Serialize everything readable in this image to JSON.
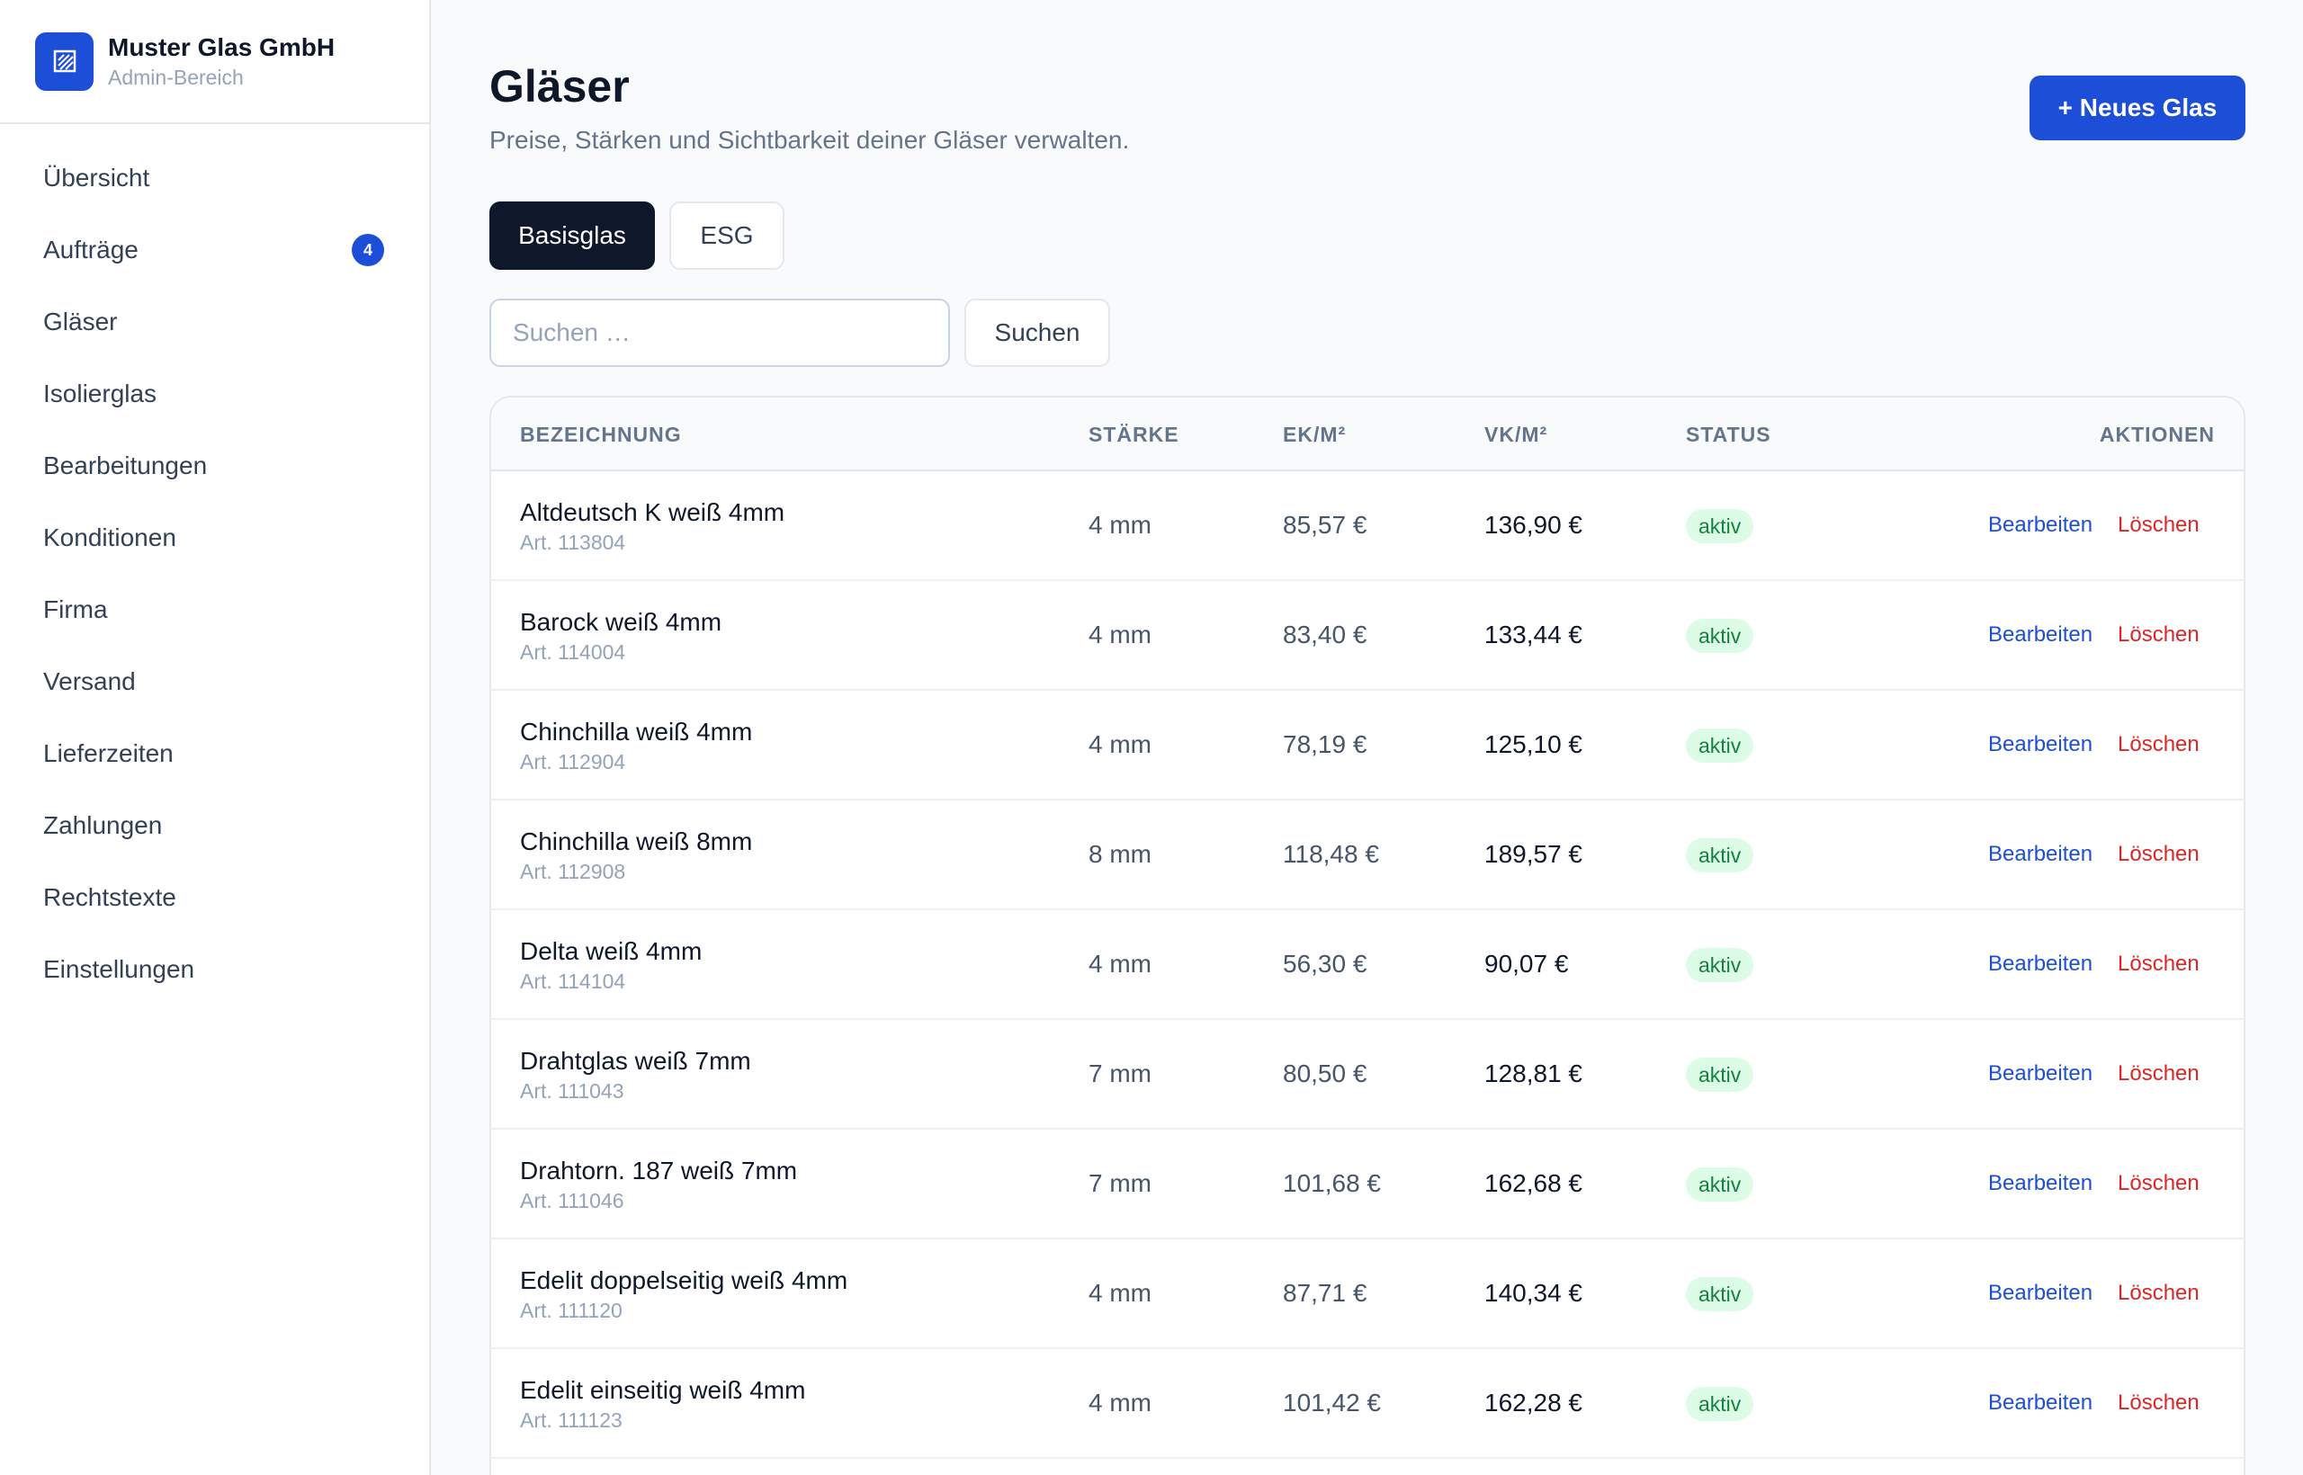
{
  "brand": {
    "name": "Muster Glas GmbH",
    "subtitle": "Admin-Bereich",
    "logo_icon": "glass-pane-icon"
  },
  "sidebar": {
    "items": [
      {
        "label": "Übersicht",
        "badge": null
      },
      {
        "label": "Aufträge",
        "badge": "4"
      },
      {
        "label": "Gläser",
        "badge": null
      },
      {
        "label": "Isolierglas",
        "badge": null
      },
      {
        "label": "Bearbeitungen",
        "badge": null
      },
      {
        "label": "Konditionen",
        "badge": null
      },
      {
        "label": "Firma",
        "badge": null
      },
      {
        "label": "Versand",
        "badge": null
      },
      {
        "label": "Lieferzeiten",
        "badge": null
      },
      {
        "label": "Zahlungen",
        "badge": null
      },
      {
        "label": "Rechtstexte",
        "badge": null
      },
      {
        "label": "Einstellungen",
        "badge": null
      }
    ]
  },
  "header": {
    "title": "Gläser",
    "subtitle": "Preise, Stärken und Sichtbarkeit deiner Gläser verwalten.",
    "new_button": "+ Neues Glas"
  },
  "tabs": [
    {
      "label": "Basisglas",
      "active": true
    },
    {
      "label": "ESG",
      "active": false
    }
  ],
  "search": {
    "placeholder": "Suchen …",
    "value": "",
    "button": "Suchen"
  },
  "table": {
    "columns": {
      "name": "BEZEICHNUNG",
      "thickness": "STÄRKE",
      "ek": "EK/M²",
      "vk": "VK/M²",
      "status": "STATUS",
      "actions": "AKTIONEN"
    },
    "edit_label": "Bearbeiten",
    "delete_label": "Löschen",
    "rows": [
      {
        "name": "Altdeutsch K weiß 4mm",
        "art": "Art. 113804",
        "thickness": "4 mm",
        "ek": "85,57 €",
        "vk": "136,90 €",
        "status": "aktiv"
      },
      {
        "name": "Barock weiß 4mm",
        "art": "Art. 114004",
        "thickness": "4 mm",
        "ek": "83,40 €",
        "vk": "133,44 €",
        "status": "aktiv"
      },
      {
        "name": "Chinchilla weiß 4mm",
        "art": "Art. 112904",
        "thickness": "4 mm",
        "ek": "78,19 €",
        "vk": "125,10 €",
        "status": "aktiv"
      },
      {
        "name": "Chinchilla weiß 8mm",
        "art": "Art. 112908",
        "thickness": "8 mm",
        "ek": "118,48 €",
        "vk": "189,57 €",
        "status": "aktiv"
      },
      {
        "name": "Delta weiß 4mm",
        "art": "Art. 114104",
        "thickness": "4 mm",
        "ek": "56,30 €",
        "vk": "90,07 €",
        "status": "aktiv"
      },
      {
        "name": "Drahtglas weiß 7mm",
        "art": "Art. 111043",
        "thickness": "7 mm",
        "ek": "80,50 €",
        "vk": "128,81 €",
        "status": "aktiv"
      },
      {
        "name": "Drahtorn. 187 weiß 7mm",
        "art": "Art. 111046",
        "thickness": "7 mm",
        "ek": "101,68 €",
        "vk": "162,68 €",
        "status": "aktiv"
      },
      {
        "name": "Edelit doppelseitig weiß 4mm",
        "art": "Art. 111120",
        "thickness": "4 mm",
        "ek": "87,71 €",
        "vk": "140,34 €",
        "status": "aktiv"
      },
      {
        "name": "Edelit einseitig weiß 4mm",
        "art": "Art. 111123",
        "thickness": "4 mm",
        "ek": "101,42 €",
        "vk": "162,28 €",
        "status": "aktiv"
      }
    ]
  },
  "colors": {
    "accent": "#1d4ed8",
    "active_tab": "#0f172a",
    "status_bg": "#dcfce7",
    "status_text": "#15803d",
    "delete": "#dc2626"
  }
}
